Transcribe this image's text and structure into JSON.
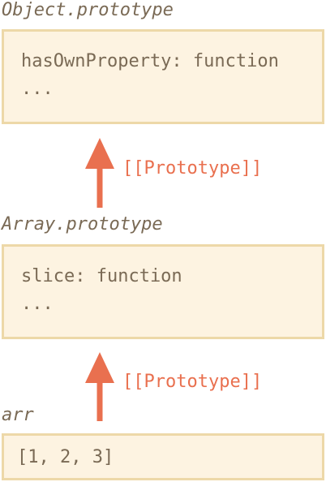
{
  "nodes": [
    {
      "title": "Object.prototype",
      "lines": [
        "hasOwnProperty: function",
        "..."
      ]
    },
    {
      "title": "Array.prototype",
      "lines": [
        "slice: function",
        "..."
      ]
    },
    {
      "title": "arr",
      "lines": [
        "[1, 2, 3]"
      ]
    }
  ],
  "links": [
    {
      "label": "[[Prototype]]"
    },
    {
      "label": "[[Prototype]]"
    }
  ],
  "colors": {
    "box_fill": "#fdf3e1",
    "box_border": "#edd8a8",
    "text": "#7a6a55",
    "arrow": "#e9704f"
  }
}
